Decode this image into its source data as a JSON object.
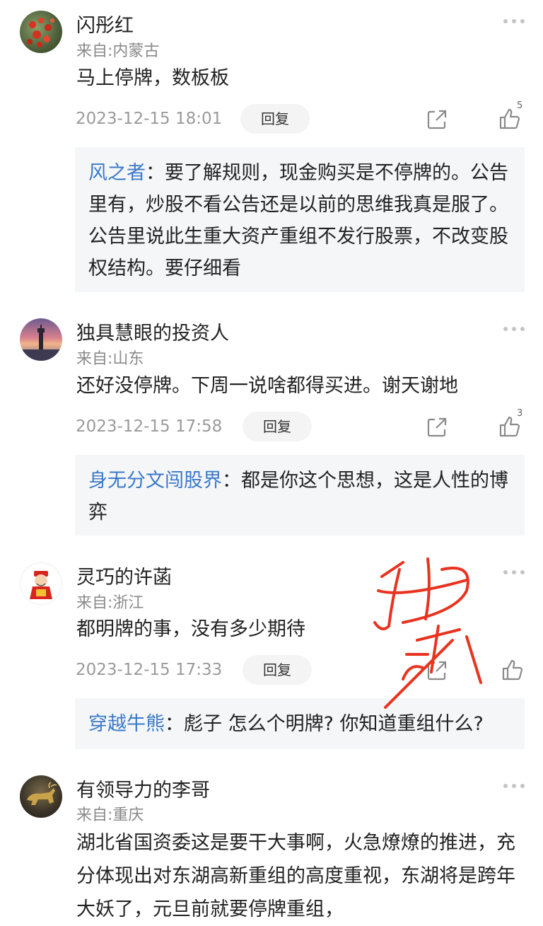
{
  "comments": [
    {
      "name": "闪彤红",
      "location": "来自:内蒙古",
      "content": "马上停牌，数板板",
      "time": "2023-12-15 18:01",
      "reply_label": "回复",
      "like_count": "5",
      "avatar_icon": "red-berries-avatar",
      "sub_replies": [
        {
          "who": "风之者",
          "text": "要了解规则，现金购买是不停牌的。公告里有，炒股不看公告还是以前的思维我真是服了。公告里说此生重大资产重组不发行股票，不改变股权结构。要仔细看"
        }
      ]
    },
    {
      "name": "独具慧眼的投资人",
      "location": "来自:山东",
      "content": "还好没停牌。下周一说啥都得买进。谢天谢地",
      "time": "2023-12-15 17:58",
      "reply_label": "回复",
      "like_count": "3",
      "avatar_icon": "lighthouse-sunset-avatar",
      "sub_replies": [
        {
          "who": "身无分文闯股界",
          "text": "都是你这个思想，这是人性的博弈"
        }
      ]
    },
    {
      "name": "灵巧的许菡",
      "location": "来自:浙江",
      "content": "都明牌的事，没有多少期待",
      "time": "2023-12-15 17:33",
      "reply_label": "回复",
      "like_count": "",
      "avatar_icon": "fortune-god-avatar",
      "sub_replies": [
        {
          "who": "穿越牛熊",
          "text": "彪子  怎么个明牌? 你知道重组什么?"
        }
      ]
    },
    {
      "name": "有领导力的李哥",
      "location": "来自:重庆",
      "content": "湖北省国资委这是要干大事啊，火急燎燎的推进，充分体现出对东湖高新重组的高度重视，东湖将是跨年大妖了，元旦前就要停牌重组，",
      "time": "",
      "reply_label": "",
      "like_count": "",
      "avatar_icon": "bull-statue-avatar",
      "sub_replies": []
    }
  ],
  "colors": {
    "link_blue": "#3a79c9",
    "stamp_red": "#e8331f",
    "sub_bg": "#f5f6f8"
  },
  "icons": {
    "more": "more-dots-icon",
    "share": "share-icon",
    "like": "thumbs-up-icon"
  }
}
